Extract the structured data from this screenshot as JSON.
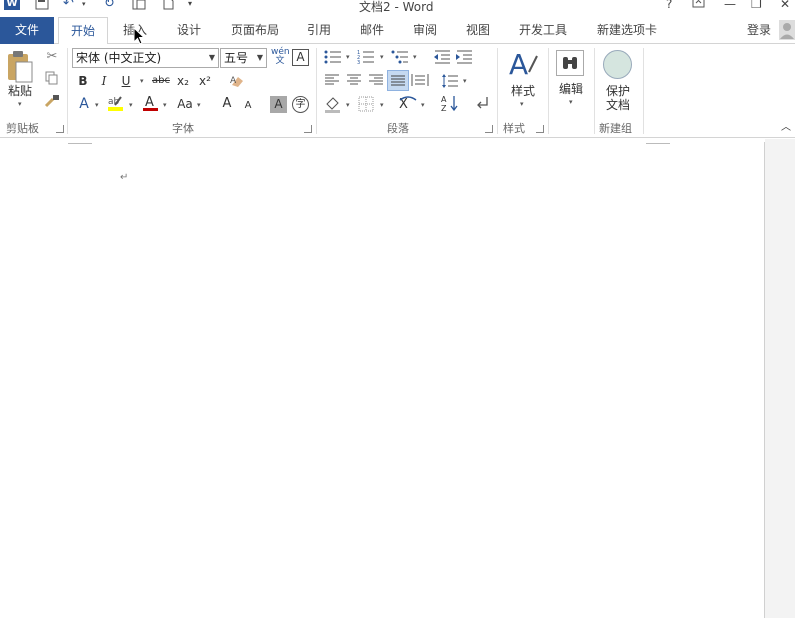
{
  "title": "文档2 - Word",
  "window_controls": {
    "help": "?",
    "minimize": "—",
    "restore": "❐",
    "close": "✕"
  },
  "tabs": [
    {
      "label": "文件"
    },
    {
      "label": "开始"
    },
    {
      "label": "插入"
    },
    {
      "label": "设计"
    },
    {
      "label": "页面布局"
    },
    {
      "label": "引用"
    },
    {
      "label": "邮件"
    },
    {
      "label": "审阅"
    },
    {
      "label": "视图"
    },
    {
      "label": "开发工具"
    },
    {
      "label": "新建选项卡"
    }
  ],
  "login": "登录",
  "ribbon": {
    "clipboard": {
      "label": "剪贴板",
      "paste": "粘贴"
    },
    "font": {
      "label": "字体",
      "font_name": "宋体 (中文正文)",
      "font_size": "五号",
      "bold": "B",
      "italic": "I",
      "underline": "U",
      "strike": "abc",
      "subscript": "x₂",
      "superscript": "x²",
      "change_case": "Aa",
      "grow": "A",
      "shrink": "A",
      "phonetic": "wén 文",
      "border_char": "A",
      "shade_char": "A",
      "enclose": "字"
    },
    "paragraph": {
      "label": "段落"
    },
    "styles": {
      "label": "样式",
      "button": "样式"
    },
    "editing": {
      "button": "编辑"
    },
    "protect": {
      "label": "新建组",
      "button_line1": "保护",
      "button_line2": "文档"
    }
  },
  "document": {
    "paragraph_mark": "↵"
  },
  "colors": {
    "accent": "#2b579a",
    "font_color_bar": "#c00000",
    "highlight_bar": "#ffff00"
  }
}
